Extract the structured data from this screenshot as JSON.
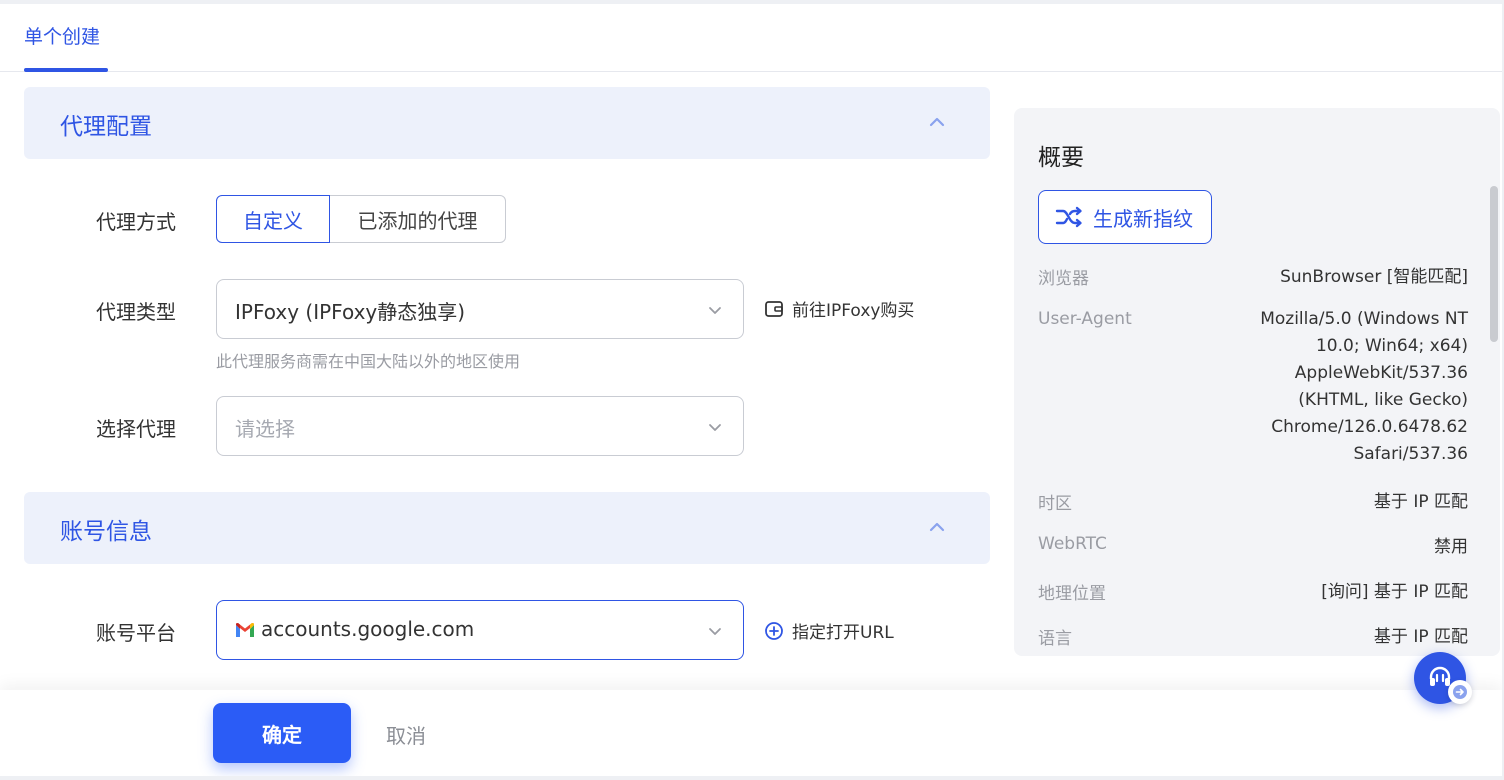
{
  "tabs": {
    "active_label": "单个创建"
  },
  "proxy_section": {
    "title": "代理配置",
    "method": {
      "label": "代理方式",
      "options": [
        "自定义",
        "已添加的代理"
      ],
      "selected": "自定义"
    },
    "type": {
      "label": "代理类型",
      "value": "IPFoxy (IPFoxy静态独享)",
      "help": "此代理服务商需在中国大陆以外的地区使用",
      "link": "前往IPFoxy购买"
    },
    "select": {
      "label": "选择代理",
      "placeholder": "请选择"
    }
  },
  "account_section": {
    "title": "账号信息",
    "platform": {
      "label": "账号平台",
      "value": "accounts.google.com",
      "link": "指定打开URL"
    }
  },
  "footer": {
    "confirm": "确定",
    "cancel": "取消"
  },
  "summary": {
    "title": "概要",
    "generate_button": "生成新指纹",
    "rows": [
      {
        "key": "浏览器",
        "value": "SunBrowser [智能匹配]"
      },
      {
        "key": "User-Agent",
        "value_lines": [
          "Mozilla/5.0 (Windows NT",
          "10.0; Win64; x64)",
          "AppleWebKit/537.36",
          "(KHTML, like Gecko)",
          "Chrome/126.0.6478.62",
          "Safari/537.36"
        ]
      },
      {
        "key": "时区",
        "value": "基于 IP 匹配"
      },
      {
        "key": "WebRTC",
        "value": "禁用"
      },
      {
        "key": "地理位置",
        "value": "[询问] 基于 IP 匹配"
      },
      {
        "key": "语言",
        "value": "基于 IP 匹配"
      }
    ]
  },
  "colors": {
    "accent": "#2f55e4",
    "primary_button": "#2b5cf6",
    "section_bg": "#edf1fb"
  },
  "icons": [
    "chevron-up-icon",
    "chevron-down-icon",
    "wallet-icon",
    "gmail-icon",
    "plus-circle-icon",
    "shuffle-icon",
    "headset-icon",
    "arrow-right-icon"
  ]
}
